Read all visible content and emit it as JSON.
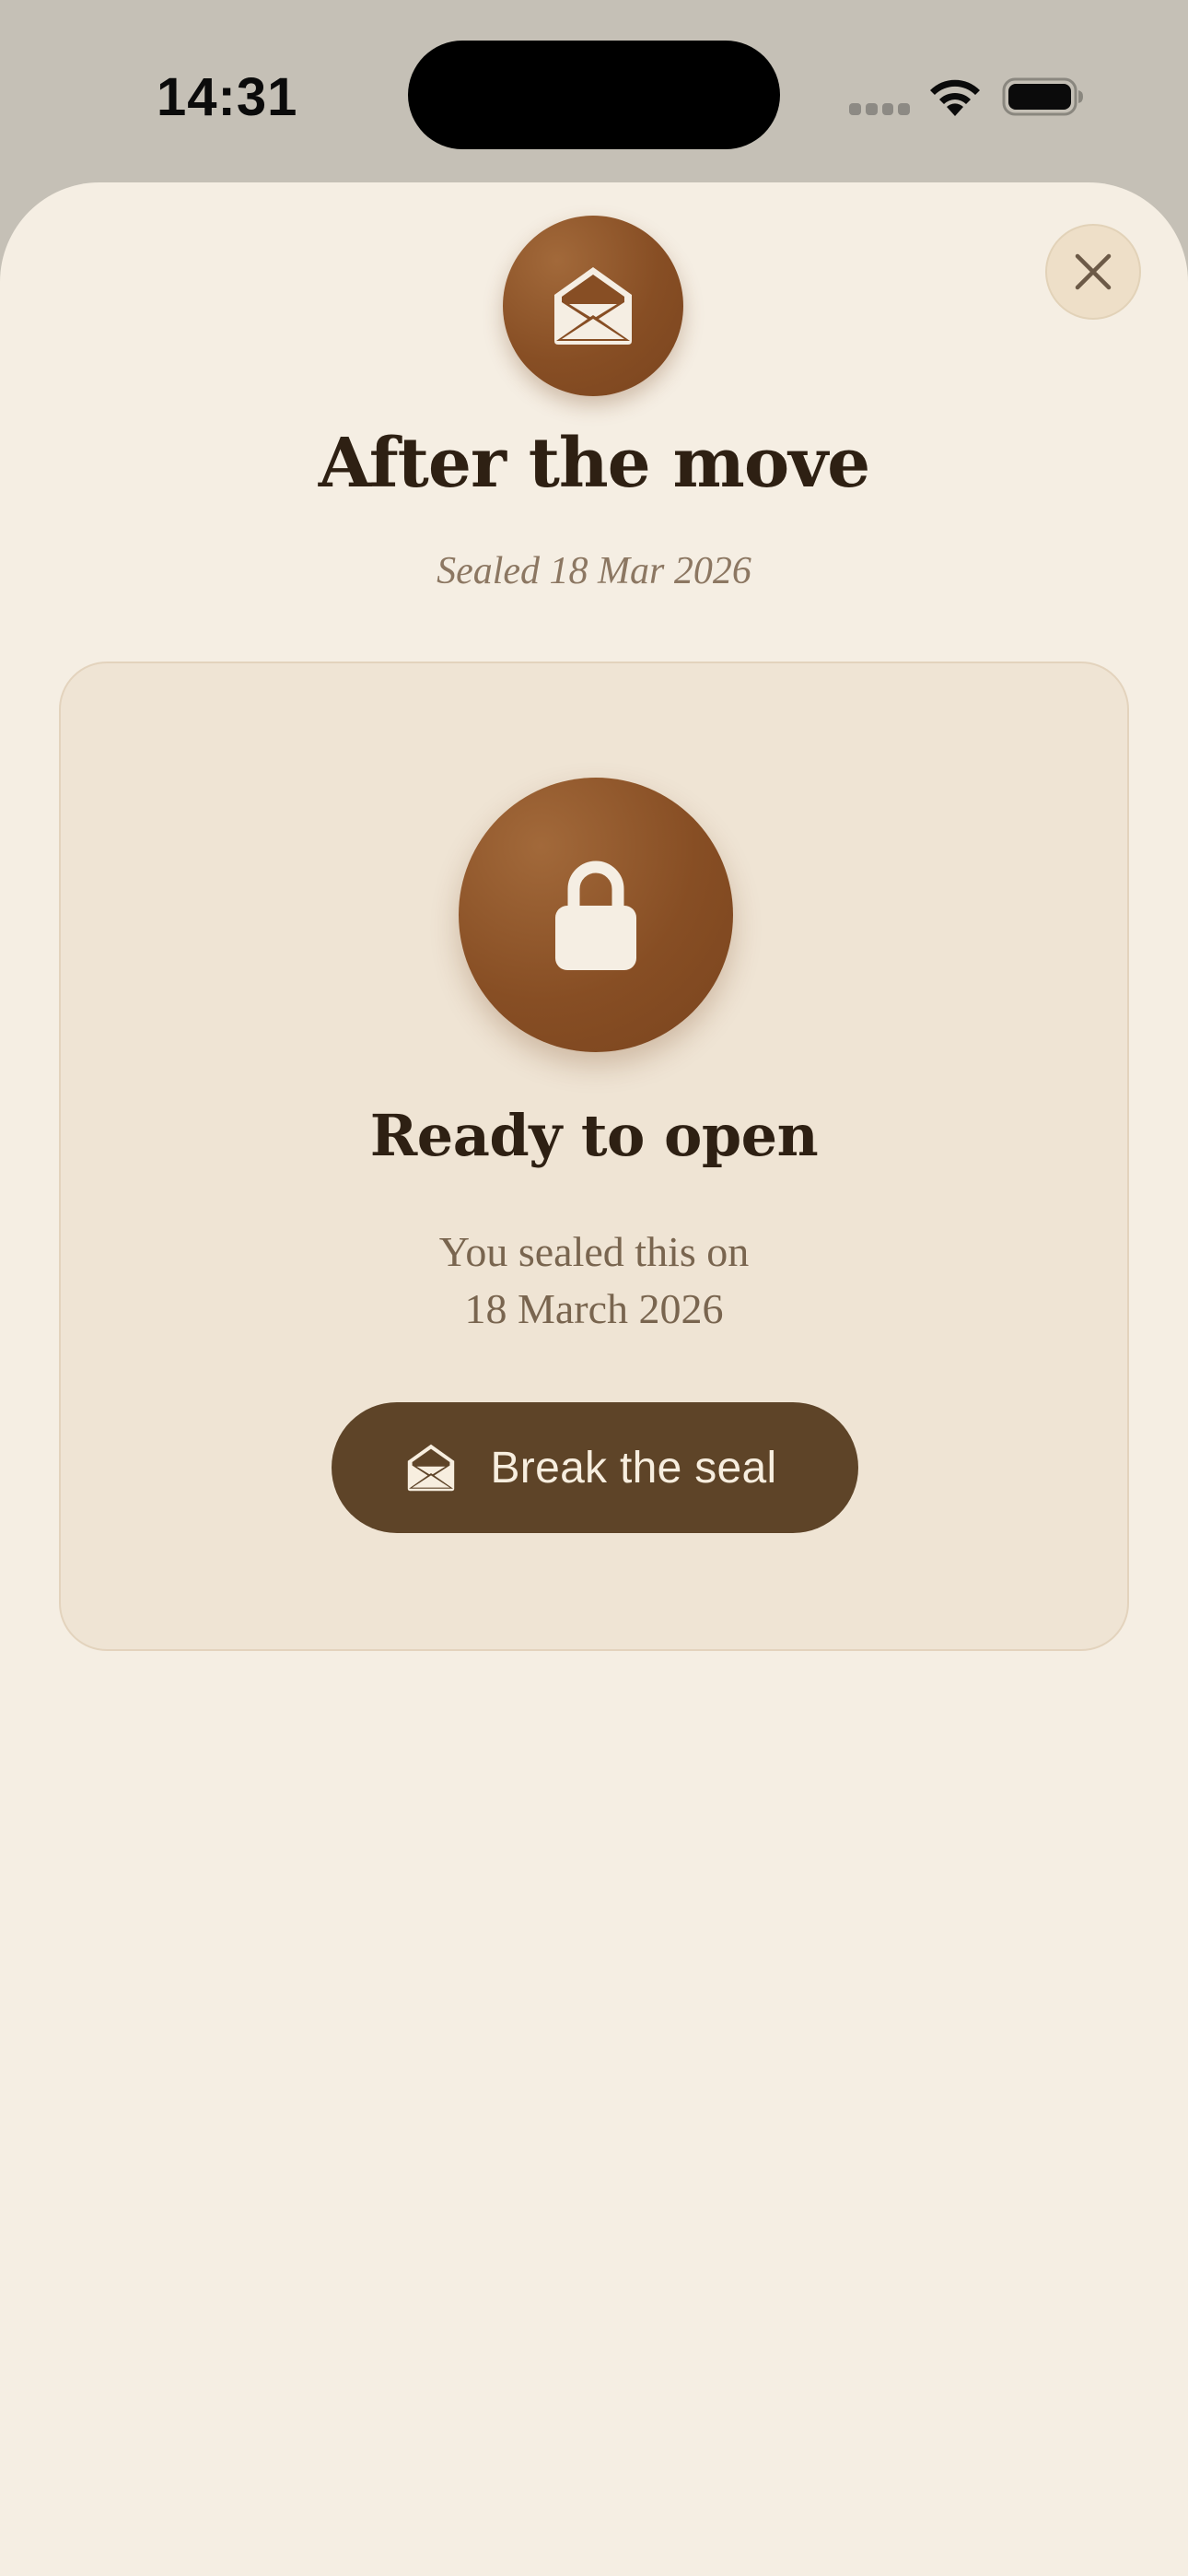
{
  "status_bar": {
    "time": "14:31"
  },
  "header": {
    "title": "After the move",
    "subtitle": "Sealed 18 Mar 2026",
    "badge_icon": "envelope-open-icon",
    "close_icon": "close-icon"
  },
  "card": {
    "icon": "lock-icon",
    "title": "Ready to open",
    "desc_line1": "You sealed this on",
    "desc_line2": "18 March 2026",
    "button_label": "Break the seal",
    "button_icon": "envelope-open-icon"
  },
  "colors": {
    "sheet_background": "#F5EEE3",
    "card_background": "#EFE4D4",
    "accent_brown": "#874E24",
    "button_brown": "#5E4428",
    "title_text": "#2E2013"
  }
}
